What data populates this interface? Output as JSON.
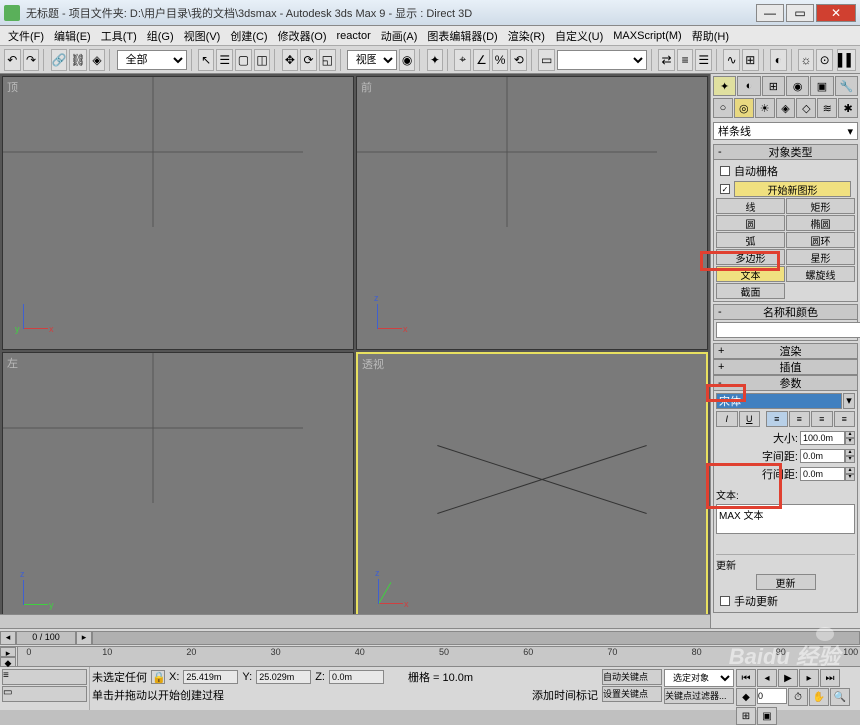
{
  "titlebar": {
    "title": "无标题   - 项目文件夹: D:\\用户目录\\我的文档\\3dsmax   - Autodesk 3ds Max 9     - 显示 : Direct 3D"
  },
  "menu": {
    "file": "文件(F)",
    "edit": "编辑(E)",
    "tools": "工具(T)",
    "group": "组(G)",
    "views": "视图(V)",
    "create": "创建(C)",
    "modifiers": "修改器(O)",
    "reactor": "reactor",
    "animation": "动画(A)",
    "graph": "图表编辑器(D)",
    "rendering": "渲染(R)",
    "customize": "自定义(U)",
    "maxscript": "MAXScript(M)",
    "help": "帮助(H)"
  },
  "toolbar": {
    "selection_set": "全部"
  },
  "viewports": {
    "top": "顶",
    "front": "前",
    "left": "左",
    "perspective": "透视"
  },
  "panel": {
    "dropdown": "样条线",
    "objtype_header": "对象类型",
    "autogrid": "自动栅格",
    "startnewshape": "开始新图形",
    "buttons": {
      "line": "线",
      "rectangle": "矩形",
      "circle": "圆",
      "ellipse": "椭圆",
      "arc": "弧",
      "donut": "圆环",
      "ngon": "多边形",
      "star": "星形",
      "text": "文本",
      "helix": "螺旋线",
      "section": "截面"
    },
    "namecolor_header": "名称和颜色",
    "rendering_header": "渲染",
    "interpolation_header": "插值",
    "parameters_header": "参数",
    "font_value": "宋体",
    "size_label": "大小:",
    "size_value": "100.0m",
    "kerning_label": "字间距:",
    "kerning_value": "0.0m",
    "leading_label": "行间距:",
    "leading_value": "0.0m",
    "text_label": "文本:",
    "text_value": "MAX 文本",
    "update_header": "更新",
    "update_btn": "更新",
    "manual_update": "手动更新",
    "italic": "I",
    "underline": "U"
  },
  "timeslider": {
    "position": "0 / 100"
  },
  "trackbar": {
    "t0": "0",
    "t10": "10",
    "t20": "20",
    "t30": "30",
    "t40": "40",
    "t50": "50",
    "t60": "60",
    "t70": "70",
    "t80": "80",
    "t90": "90",
    "t100": "100"
  },
  "status": {
    "none_selected": "未选定任何",
    "prompt": "单击并拖动以开始创建过程",
    "x_label": "X:",
    "x_value": "25.419m",
    "y_label": "Y:",
    "y_value": "25.029m",
    "z_label": "Z:",
    "z_value": "0.0m",
    "grid": "栅格 = 10.0m",
    "addtime": "添加时间标记",
    "autokey": "自动关键点",
    "setkey": "设置关键点",
    "selected": "选定对象",
    "keyfilters": "关键点过滤器..."
  },
  "watermark": "Baidu 经验"
}
